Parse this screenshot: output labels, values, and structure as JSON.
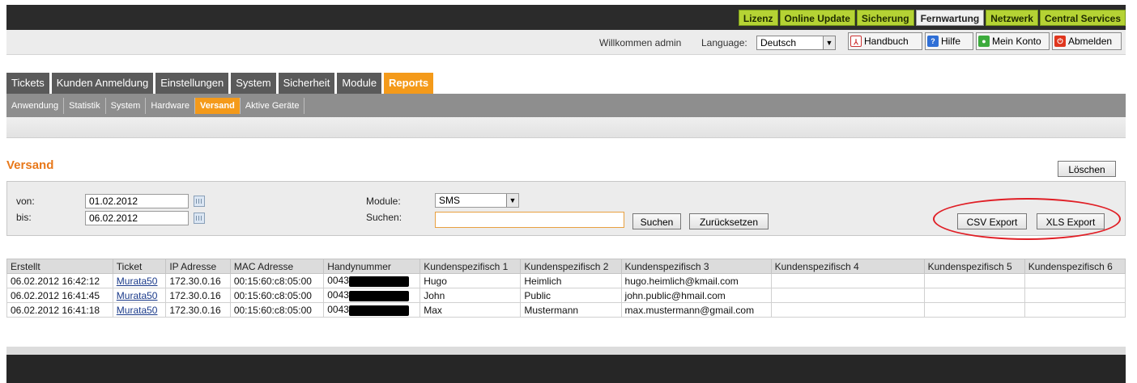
{
  "top_nav": [
    {
      "label": "Lizenz",
      "active": false
    },
    {
      "label": "Online Update",
      "active": false
    },
    {
      "label": "Sicherung",
      "active": false
    },
    {
      "label": "Fernwartung",
      "active": true
    },
    {
      "label": "Netzwerk",
      "active": false
    },
    {
      "label": "Central Services",
      "active": false
    }
  ],
  "user_bar": {
    "welcome": "Willkommen admin",
    "language_label": "Language:",
    "language_value": "Deutsch",
    "buttons": [
      "Handbuch",
      "Hilfe",
      "Mein Konto",
      "Abmelden"
    ]
  },
  "main_tabs": [
    "Tickets",
    "Kunden Anmeldung",
    "Einstellungen",
    "System",
    "Sicherheit",
    "Module",
    "Reports"
  ],
  "main_tab_active": "Reports",
  "sub_tabs": [
    "Anwendung",
    "Statistik",
    "System",
    "Hardware",
    "Versand",
    "Aktive Geräte"
  ],
  "sub_tab_active": "Versand",
  "page": {
    "title": "Versand",
    "delete_button": "Löschen"
  },
  "filter": {
    "from_label": "von:",
    "from_value": "01.02.2012",
    "to_label": "bis:",
    "to_value": "06.02.2012",
    "module_label": "Module:",
    "module_value": "SMS",
    "search_label": "Suchen:",
    "search_value": "",
    "search_button": "Suchen",
    "reset_button": "Zurücksetzen",
    "csv_button": "CSV Export",
    "xls_button": "XLS Export"
  },
  "table": {
    "columns": [
      "Erstellt",
      "Ticket",
      "IP Adresse",
      "MAC Adresse",
      "Handynummer",
      "Kundenspezifisch 1",
      "Kundenspezifisch 2",
      "Kundenspezifisch 3",
      "Kundenspezifisch 4",
      "Kundenspezifisch 5",
      "Kundenspezifisch 6"
    ],
    "rows": [
      [
        "06.02.2012 16:42:12",
        "Murata50",
        "172.30.0.16",
        "00:15:60:c8:05:00",
        "0043",
        "Hugo",
        "Heimlich",
        "hugo.heimlich@kmail.com",
        "",
        "",
        ""
      ],
      [
        "06.02.2012 16:41:45",
        "Murata50",
        "172.30.0.16",
        "00:15:60:c8:05:00",
        "0043",
        "John",
        "Public",
        "john.public@hmail.com",
        "",
        "",
        ""
      ],
      [
        "06.02.2012 16:41:18",
        "Murata50",
        "172.30.0.16",
        "00:15:60:c8:05:00",
        "0043",
        "Max",
        "Mustermann",
        "max.mustermann@gmail.com",
        "",
        "",
        ""
      ]
    ]
  },
  "colors": {
    "accent_orange": "#f49a1a",
    "nav_green": "#b5d334",
    "title_orange": "#e8781a",
    "highlight_red": "#e01f26"
  }
}
